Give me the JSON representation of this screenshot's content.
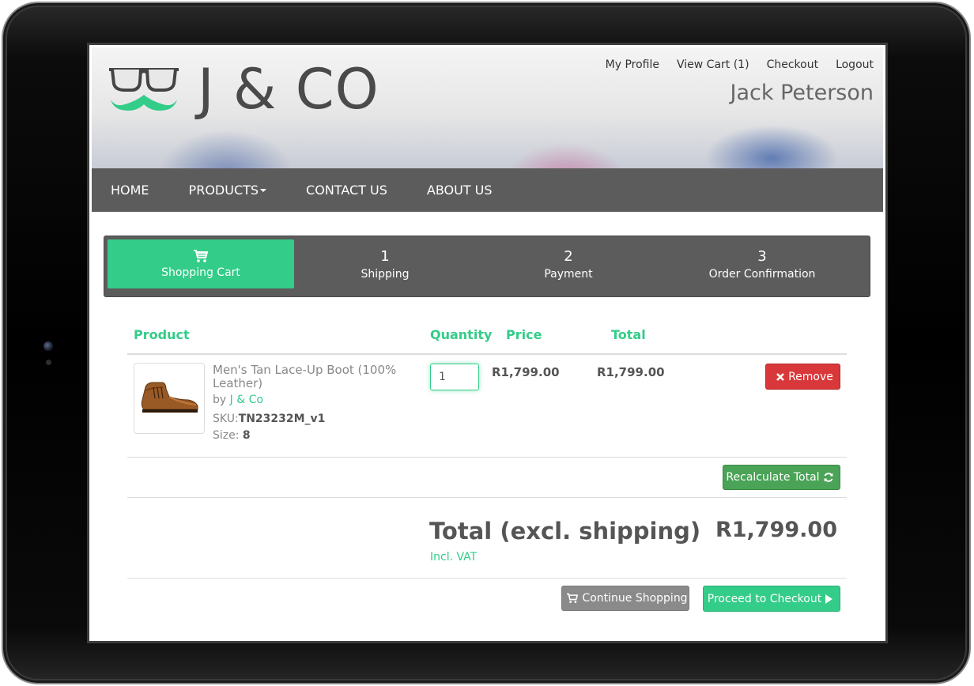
{
  "brand": {
    "name": "J & CO",
    "accent": "#33cc88",
    "logo_icon": "glasses-mustache-icon"
  },
  "top_links": {
    "profile": "My Profile",
    "cart": "View Cart (1)",
    "checkout": "Checkout",
    "logout": "Logout"
  },
  "user": {
    "name": "Jack Peterson"
  },
  "nav": {
    "home": "HOME",
    "products": "PRODUCTS",
    "contact": "CONTACT US",
    "about": "ABOUT US"
  },
  "steps": [
    {
      "label": "Shopping Cart",
      "icon": "cart-icon",
      "active": true
    },
    {
      "num": "1",
      "label": "Shipping"
    },
    {
      "num": "2",
      "label": "Payment"
    },
    {
      "num": "3",
      "label": "Order Confirmation"
    }
  ],
  "cart": {
    "headers": {
      "product": "Product",
      "quantity": "Quantity",
      "price": "Price",
      "total": "Total"
    },
    "items": [
      {
        "name": "Men's Tan Lace-Up Boot (100% Leather)",
        "by_label": "by",
        "brand": "J & Co",
        "sku_label": "SKU:",
        "sku": "TN23232M_v1",
        "size_label": "Size:",
        "size": "8",
        "quantity": "1",
        "price": "R1,799.00",
        "total": "R1,799.00",
        "remove_label": "Remove"
      }
    ],
    "recalc_label": "Recalculate Total",
    "grand_total_label": "Total (excl. shipping)",
    "grand_total_value": "R1,799.00",
    "vat_note": "Incl. VAT",
    "continue_label": "Continue Shopping",
    "proceed_label": "Proceed to Checkout"
  },
  "colors": {
    "remove": "#d9383a",
    "recalc": "#4aa356",
    "continue": "#8a8a8a",
    "nav_bg": "#5c5c5c"
  }
}
